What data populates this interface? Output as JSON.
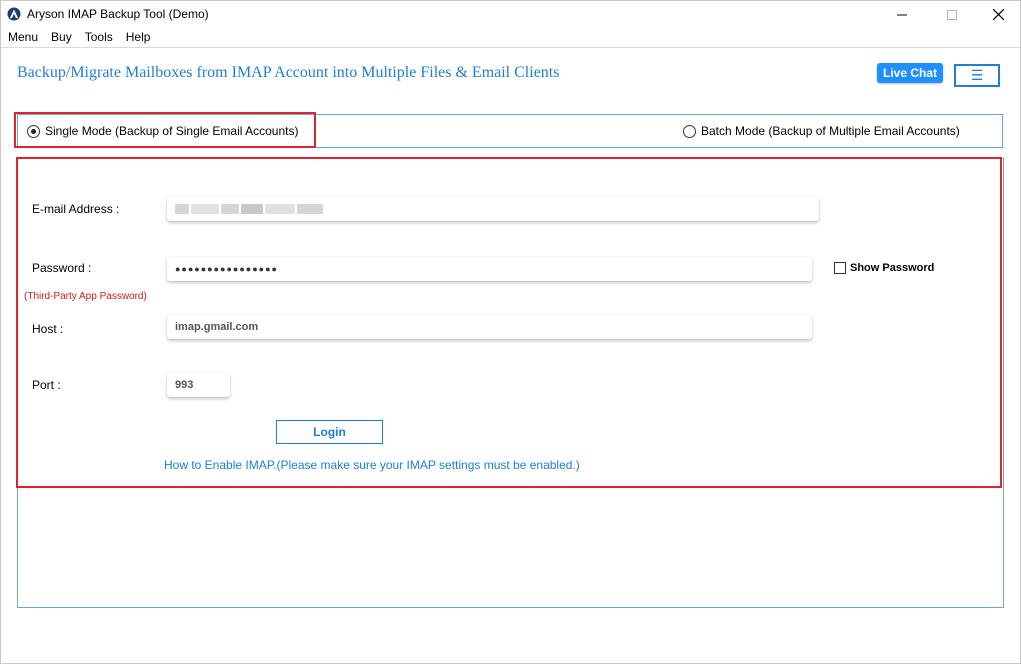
{
  "window": {
    "title": "Aryson IMAP Backup Tool (Demo)",
    "controls": {
      "minimize": "—",
      "maximize": "☐",
      "close": "✕"
    }
  },
  "menubar": {
    "items": [
      "Menu",
      "Buy",
      "Tools",
      "Help"
    ]
  },
  "header": {
    "headline": "Backup/Migrate Mailboxes from IMAP Account into Multiple Files & Email Clients",
    "live_chat_label": "Live Chat",
    "hamburger_icon": "☰"
  },
  "modes": {
    "single_label": "Single Mode (Backup of Single Email Accounts)",
    "batch_label": "Batch Mode (Backup of Multiple Email Accounts)",
    "selected": "single"
  },
  "form": {
    "email_label": "E-mail Address :",
    "password_label": "Password :",
    "password_sublabel": "(Third-Party App Password)",
    "password_value": "●●●●●●●●●●●●●●●●",
    "show_password_label": "Show Password",
    "host_label": "Host :",
    "host_value": "imap.gmail.com",
    "port_label": "Port :",
    "port_value": "993",
    "login_label": "Login",
    "help_text": "How to Enable IMAP.(Please make sure your IMAP settings must be enabled.)"
  },
  "colors": {
    "accent": "#1e7fd4",
    "live_chat_bg": "#1e90ff",
    "highlight": "#e0232e",
    "sublabel": "#d01c1c"
  }
}
